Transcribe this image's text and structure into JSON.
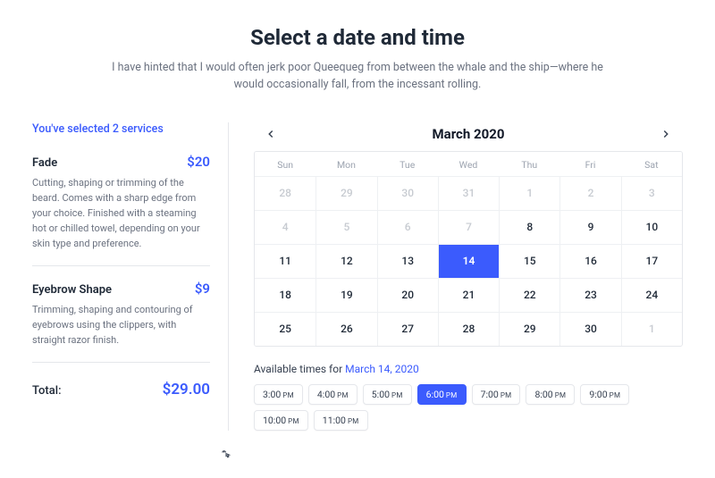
{
  "header": {
    "title": "Select a date and time",
    "subtitle": "I have hinted that I would often jerk poor Queequeg from between the whale and the ship—where he would occasionally fall, from the incessant rolling."
  },
  "summary": {
    "label": "You've selected 2 services",
    "services": [
      {
        "name": "Fade",
        "price": "$20",
        "desc": "Cutting, shaping or trimming of the beard. Comes with a sharp edge from your choice. Finished with a steaming hot or chilled towel, depending on your skin type and preference."
      },
      {
        "name": "Eyebrow Shape",
        "price": "$9",
        "desc": "Trimming, shaping and contouring of eyebrows using the clippers, with straight razor finish."
      }
    ],
    "total_label": "Total:",
    "total_value": "$29.00"
  },
  "calendar": {
    "month_label": "March 2020",
    "dow": [
      "Sun",
      "Mon",
      "Tue",
      "Wed",
      "Thu",
      "Fri",
      "Sat"
    ],
    "days": [
      {
        "n": "28",
        "muted": true
      },
      {
        "n": "29",
        "muted": true
      },
      {
        "n": "30",
        "muted": true
      },
      {
        "n": "31",
        "muted": true
      },
      {
        "n": "1",
        "muted": true
      },
      {
        "n": "2",
        "muted": true
      },
      {
        "n": "3",
        "muted": true
      },
      {
        "n": "4",
        "muted": true
      },
      {
        "n": "5",
        "muted": true
      },
      {
        "n": "6",
        "muted": true
      },
      {
        "n": "7",
        "muted": true
      },
      {
        "n": "8",
        "muted": false
      },
      {
        "n": "9",
        "muted": false
      },
      {
        "n": "10",
        "muted": false
      },
      {
        "n": "11",
        "muted": false
      },
      {
        "n": "12",
        "muted": false
      },
      {
        "n": "13",
        "muted": false
      },
      {
        "n": "14",
        "muted": false,
        "selected": true
      },
      {
        "n": "15",
        "muted": false
      },
      {
        "n": "16",
        "muted": false
      },
      {
        "n": "17",
        "muted": false
      },
      {
        "n": "18",
        "muted": false
      },
      {
        "n": "19",
        "muted": false
      },
      {
        "n": "20",
        "muted": false
      },
      {
        "n": "21",
        "muted": false
      },
      {
        "n": "22",
        "muted": false
      },
      {
        "n": "23",
        "muted": false
      },
      {
        "n": "24",
        "muted": false
      },
      {
        "n": "25",
        "muted": false
      },
      {
        "n": "26",
        "muted": false
      },
      {
        "n": "27",
        "muted": false
      },
      {
        "n": "28",
        "muted": false
      },
      {
        "n": "29",
        "muted": false
      },
      {
        "n": "30",
        "muted": false
      },
      {
        "n": "1",
        "muted": true
      }
    ]
  },
  "times": {
    "label_prefix": "Available times for ",
    "label_date": "March 14, 2020",
    "slots": [
      {
        "t": "3:00",
        "p": "PM"
      },
      {
        "t": "4:00",
        "p": "PM"
      },
      {
        "t": "5:00",
        "p": "PM"
      },
      {
        "t": "6:00",
        "p": "PM",
        "selected": true
      },
      {
        "t": "7:00",
        "p": "PM"
      },
      {
        "t": "8:00",
        "p": "PM"
      },
      {
        "t": "9:00",
        "p": "PM"
      },
      {
        "t": "10:00",
        "p": "PM"
      },
      {
        "t": "11:00",
        "p": "PM"
      }
    ]
  }
}
